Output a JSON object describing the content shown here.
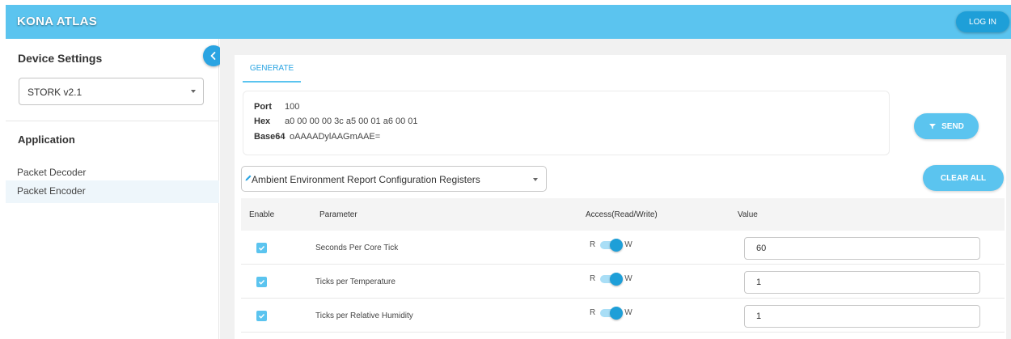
{
  "header": {
    "brand": "KONA ATLAS",
    "login_label": "LOG IN"
  },
  "sidebar": {
    "title": "Device Settings",
    "device_select": "STORK v2.1",
    "section_title": "Application",
    "items": [
      {
        "label": "Packet Decoder",
        "active": false
      },
      {
        "label": "Packet Encoder",
        "active": true
      }
    ]
  },
  "main": {
    "tab_label": "GENERATE",
    "result": {
      "port_key": "Port",
      "port_value": "100",
      "hex_key": "Hex",
      "hex_value": "a0 00 00 00 3c a5 00 01 a6 00 01",
      "base64_key": "Base64",
      "base64_value": "oAAAADylAAGmAAE="
    },
    "send_label": "SEND",
    "register_select": "Ambient Environment Report Configuration Registers",
    "clear_label": "CLEAR ALL",
    "table": {
      "headers": [
        "Enable",
        "Parameter",
        "Access(Read/Write)",
        "Value"
      ],
      "rows": [
        {
          "enabled": true,
          "parameter": "Seconds Per Core Tick",
          "read": "R",
          "write": "W",
          "value": "60"
        },
        {
          "enabled": true,
          "parameter": "Ticks per Temperature",
          "read": "R",
          "write": "W",
          "value": "1"
        },
        {
          "enabled": true,
          "parameter": "Ticks per Relative Humidity",
          "read": "R",
          "write": "W",
          "value": "1"
        }
      ]
    }
  },
  "colors": {
    "accent": "#5bc4ef",
    "accent_dark": "#1e9fd8"
  }
}
